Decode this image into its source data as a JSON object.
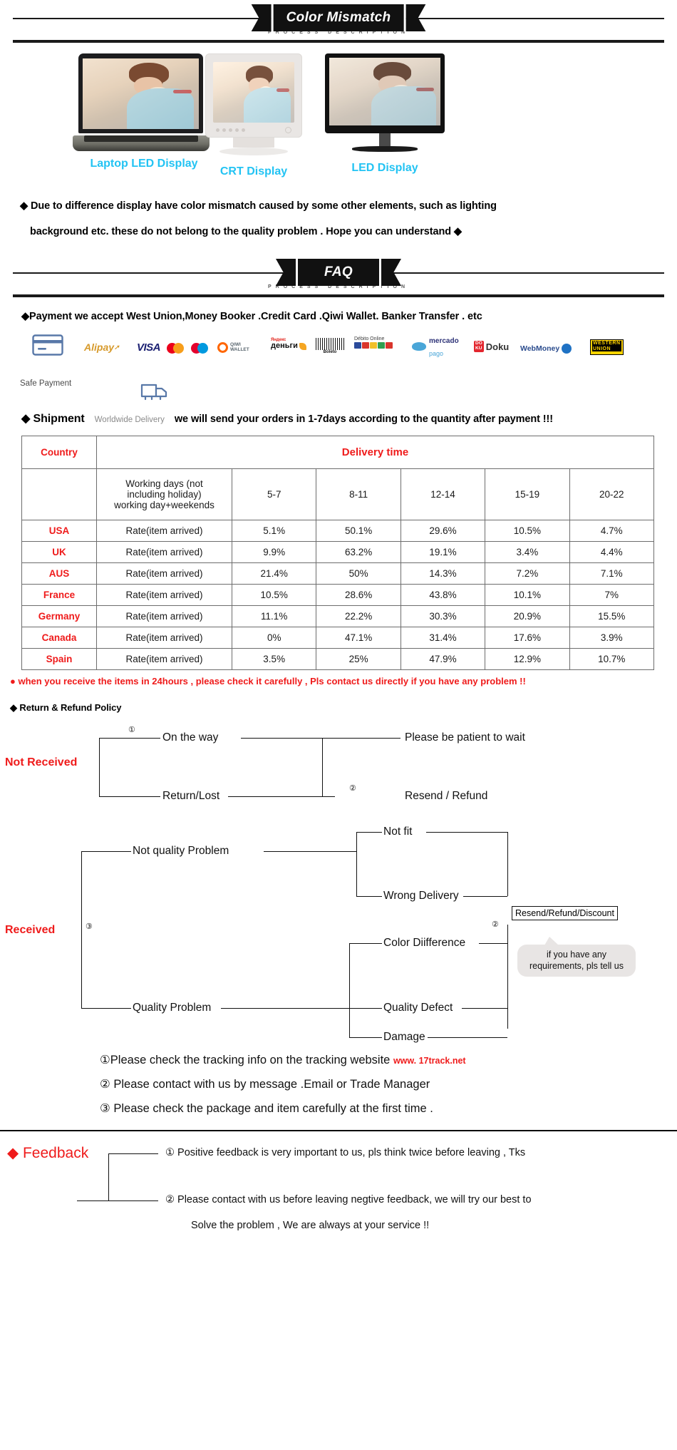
{
  "sections": {
    "color_mismatch": {
      "banner_title": "Color Mismatch",
      "banner_sub": "PROCESS DESCRIPTION",
      "displays": [
        {
          "label": "Laptop LED Display",
          "type": "laptop"
        },
        {
          "label": "CRT Display",
          "type": "crt"
        },
        {
          "label": "LED  Display",
          "type": "led"
        }
      ],
      "note_line1": "◆ Due to difference display have color mismatch caused by some other elements, such as lighting",
      "note_line2": "background etc.  these do not belong to the quality problem . Hope you can understand ◆"
    },
    "faq": {
      "banner_title": "FAQ",
      "banner_sub": "PROCESS DESCRIPTION",
      "payment_line": "◆Payment we accept West Union,Money Booker .Credit Card .Qiwi Wallet. Banker Transfer . etc",
      "safe_payment_label": "Safe Payment",
      "payment_logos": [
        "alipay",
        "visa",
        "mastercard",
        "maestro",
        "qiwi-wallet",
        "yandex-dengi",
        "boleto",
        "debito-online",
        "mercado-pago",
        "doku",
        "webmoney",
        "western-union"
      ],
      "payment_logo_text": {
        "alipay": "Alipay",
        "visa": "VISA",
        "qiwi_line1": "QIWI",
        "qiwi_line2": "WALLET",
        "yandex_top": "Яндекс",
        "yandex_bottom": "деньги",
        "boleto": "Boleto",
        "debito": "Débito Online",
        "mercado_1": "mercado",
        "mercado_2": "pago",
        "doku_sq1": "DO",
        "doku_sq2": "KU",
        "doku": "Doku",
        "webmoney": "WebMoney",
        "wu_1": "WESTERN",
        "wu_2": "UNION"
      },
      "shipment_label": "◆ Shipment",
      "worldwide_label": "Worldwide Delivery",
      "shipment_text": "we will send your orders in 1-7days according to the quantity after payment  !!!",
      "receive_note": "● when you receive the items in 24hours , please check it carefully , Pls contact us directly if you have any problem !!"
    },
    "policy": {
      "title": "◆  Return & Refund Policy",
      "not_received": {
        "group_label": "Not Received",
        "marker": "①",
        "branch1": "On the way",
        "branch1_result": "Please be patient to wait",
        "branch2": "Return/Lost",
        "branch2_marker": "②",
        "branch2_result": "Resend / Refund"
      },
      "received": {
        "group_label": "Received",
        "marker": "③",
        "not_quality": "Not quality Problem",
        "not_quality_items": [
          "Not fit",
          "Wrong Delivery"
        ],
        "quality": "Quality Problem",
        "quality_items": [
          "Color Diifference",
          "Quality Defect",
          "Damage"
        ],
        "result_marker": "②",
        "result_box": "Resend/Refund/Discount",
        "bubble_line1": "if you have any",
        "bubble_line2": "requirements, pls tell us"
      },
      "notes": [
        {
          "num": "①",
          "text": "Please check the tracking info on the tracking website ",
          "link": "www. 17track.net"
        },
        {
          "num": "②",
          "text": " Please contact with us by message .Email or Trade Manager",
          "link": ""
        },
        {
          "num": "③",
          "text": " Please check the package and item carefully at the first time .",
          "link": ""
        }
      ]
    },
    "feedback": {
      "title": "◆ Feedback",
      "items": [
        {
          "num": "①",
          "line1": " Positive feedback is very important to us, pls think twice before leaving , Tks",
          "line2": ""
        },
        {
          "num": "②",
          "line1": " Please contact with us before leaving negtive feedback, we will try our best to",
          "line2": "Solve the problem , We are always at your service !!"
        }
      ]
    }
  },
  "table_data": {
    "header_country": "Country",
    "header_delivery": "Delivery time",
    "subheader_rate_l1": "Working days (not",
    "subheader_rate_l2": "including holiday)",
    "subheader_rate_l3": "working day+weekends",
    "day_ranges": [
      "5-7",
      "8-11",
      "12-14",
      "15-19",
      "20-22"
    ],
    "rate_label": "Rate(item arrived)",
    "rows": [
      {
        "country": "USA",
        "values": [
          "5.1%",
          "50.1%",
          "29.6%",
          "10.5%",
          "4.7%"
        ]
      },
      {
        "country": "UK",
        "values": [
          "9.9%",
          "63.2%",
          "19.1%",
          "3.4%",
          "4.4%"
        ]
      },
      {
        "country": "AUS",
        "values": [
          "21.4%",
          "50%",
          "14.3%",
          "7.2%",
          "7.1%"
        ]
      },
      {
        "country": "France",
        "values": [
          "10.5%",
          "28.6%",
          "43.8%",
          "10.1%",
          "7%"
        ]
      },
      {
        "country": "Germany",
        "values": [
          "11.1%",
          "22.2%",
          "30.3%",
          "20.9%",
          "15.5%"
        ]
      },
      {
        "country": "Canada",
        "values": [
          "0%",
          "47.1%",
          "31.4%",
          "17.6%",
          "3.9%"
        ]
      },
      {
        "country": "Spain",
        "values": [
          "3.5%",
          "25%",
          "47.9%",
          "12.9%",
          "10.7%"
        ]
      }
    ]
  },
  "colors": {
    "accent_red": "#ef1b1b",
    "cyan_label": "#22c3f3",
    "banner_black": "#111111"
  }
}
